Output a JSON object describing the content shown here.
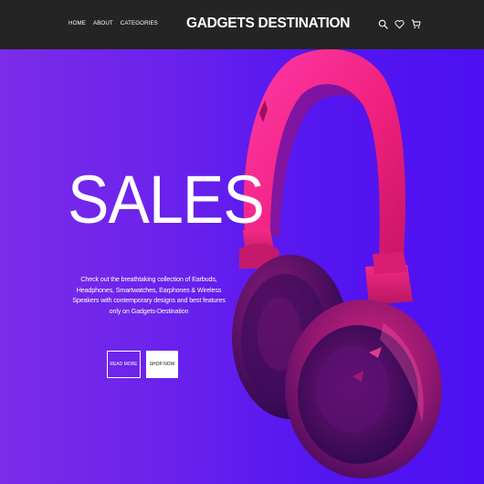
{
  "nav": {
    "links": [
      "HOME",
      "ABOUT",
      "CATEGORIES"
    ],
    "brand": "GADGETS DESTINATION",
    "icons": [
      "search-icon",
      "heart-icon",
      "cart-icon"
    ]
  },
  "hero": {
    "title": "SALES",
    "description": "Check out the breathtaking collection of Earbuds, Headphones, Smartwatches, Earphones & Wireless Speakers with contemporary designs and best features only on Gadgets-Destination",
    "buttons": {
      "read_more": "READ MORE",
      "shop_now": "SHOP NOW"
    },
    "product_image": "headphones",
    "background_colors": [
      "#7c2ce8",
      "#4d10f2"
    ]
  }
}
